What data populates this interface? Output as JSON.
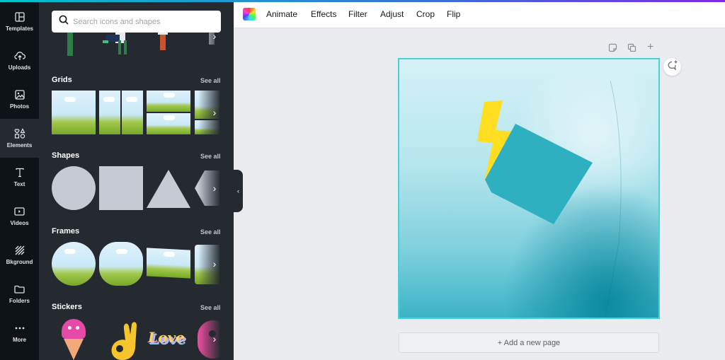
{
  "sidebar": {
    "items": [
      {
        "label": "Templates",
        "icon": "templates-icon"
      },
      {
        "label": "Uploads",
        "icon": "upload-cloud-icon"
      },
      {
        "label": "Photos",
        "icon": "photo-icon"
      },
      {
        "label": "Elements",
        "icon": "elements-icon",
        "active": true
      },
      {
        "label": "Text",
        "icon": "text-icon"
      },
      {
        "label": "Videos",
        "icon": "video-icon"
      },
      {
        "label": "Bkground",
        "icon": "background-icon"
      },
      {
        "label": "Folders",
        "icon": "folder-icon"
      },
      {
        "label": "More",
        "icon": "more-icon"
      }
    ]
  },
  "panel": {
    "search": {
      "placeholder": "Search icons and shapes",
      "value": ""
    },
    "sections": [
      {
        "title": "Grids",
        "see_all": "See all"
      },
      {
        "title": "Shapes",
        "see_all": "See all"
      },
      {
        "title": "Frames",
        "see_all": "See all"
      },
      {
        "title": "Stickers",
        "see_all": "See all"
      }
    ],
    "stickers": [
      "ice-cream",
      "ok-hand",
      "Love",
      "donut"
    ]
  },
  "toolbar": {
    "items": [
      "Animate",
      "Effects",
      "Filter",
      "Adjust",
      "Crop",
      "Flip"
    ]
  },
  "canvas": {
    "add_page_label": "+ Add a new page",
    "accent": "#4ad0d8",
    "shape_color": "#2fb0c0",
    "bolt_color": "#ffde21"
  },
  "colors": {
    "rail_bg": "#0e1318",
    "panel_bg": "#252a31",
    "workspace_bg": "#ebecf0"
  }
}
